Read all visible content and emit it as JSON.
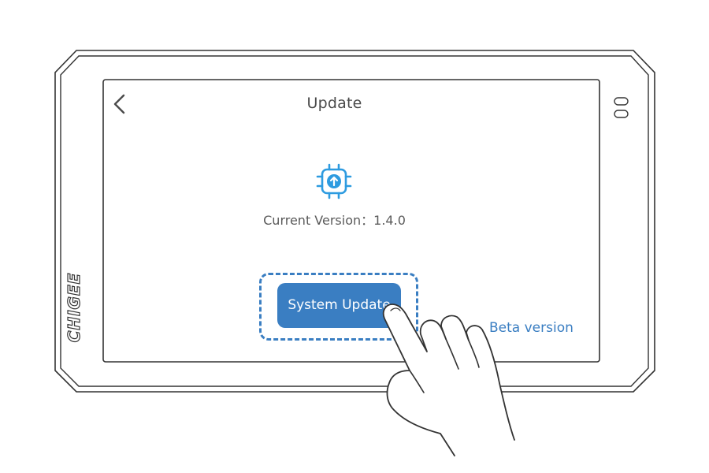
{
  "header": {
    "title": "Update",
    "back_icon": "chevron-left-icon"
  },
  "firmware": {
    "icon": "chip-upload-icon",
    "version_label": "Current Version",
    "separator": "：",
    "version_value": "1.4.0"
  },
  "actions": {
    "system_update_label": "System Update",
    "beta_label": "Beta version"
  },
  "brand": {
    "logo_text": "CHIGEE"
  },
  "colors": {
    "accent": "#3a7ec2",
    "icon": "#2d9be0",
    "text": "#4a4a4a",
    "frame": "#333333"
  },
  "illustration": {
    "gesture": "tap-hand-icon"
  }
}
